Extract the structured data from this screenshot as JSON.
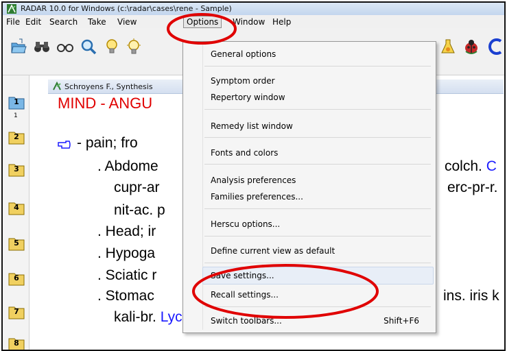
{
  "window": {
    "title": "RADAR 10.0 for Windows  (c:\\radar\\cases\\rene - Sample)"
  },
  "menubar": {
    "items": [
      "File",
      "Edit",
      "Search",
      "Take",
      "View",
      "Options",
      "Window",
      "Help"
    ]
  },
  "document": {
    "header": "Schroyens F., Synthesis",
    "heading": "MIND - ANGU",
    "lines": [
      "- pain; fro",
      ". Abdome",
      "cupr-ar",
      "nit-ac. p",
      ". Head; ir",
      ". Hypoga",
      ". Sciatic r",
      ". Stomac",
      "kali-br. Lyc. med. merc-c. merc-pr-r. orni. ox"
    ],
    "right_fragments": [
      "colch. C",
      "erc-pr-r.",
      "ins. iris k"
    ],
    "small_number": "1",
    "folder_numbers": [
      "1",
      "2",
      "3",
      "4",
      "5",
      "6",
      "7",
      "8"
    ],
    "colors": {
      "heading": "#e00000",
      "remedy_blue": "#1a1aff"
    }
  },
  "options_menu": {
    "items": [
      {
        "label": "General options",
        "shortcut": ""
      },
      {
        "label": "Symptom order",
        "shortcut": ""
      },
      {
        "label": "Repertory window",
        "shortcut": ""
      },
      {
        "label": "Remedy list window",
        "shortcut": ""
      },
      {
        "label": "Fonts and colors",
        "shortcut": ""
      },
      {
        "label": "Analysis preferences",
        "shortcut": ""
      },
      {
        "label": "Families preferences...",
        "shortcut": ""
      },
      {
        "label": "Herscu options...",
        "shortcut": ""
      },
      {
        "label": "Define current view as default",
        "shortcut": ""
      },
      {
        "label": "Save settings...",
        "shortcut": ""
      },
      {
        "label": "Recall settings...",
        "shortcut": ""
      },
      {
        "label": "Switch toolbars...",
        "shortcut": "Shift+F6"
      }
    ],
    "highlighted": "Save settings..."
  },
  "icons": [
    "app-logo-icon",
    "open-folder-icon",
    "binoculars-icon",
    "glasses-icon",
    "magnifier-icon",
    "lightbulb-icon",
    "lightbulb-ray-icon",
    "flask-icon",
    "ladybug-icon",
    "blue-arc-icon",
    "pointing-hand-icon",
    "folder-icon"
  ],
  "annotation_color": "#e00000"
}
